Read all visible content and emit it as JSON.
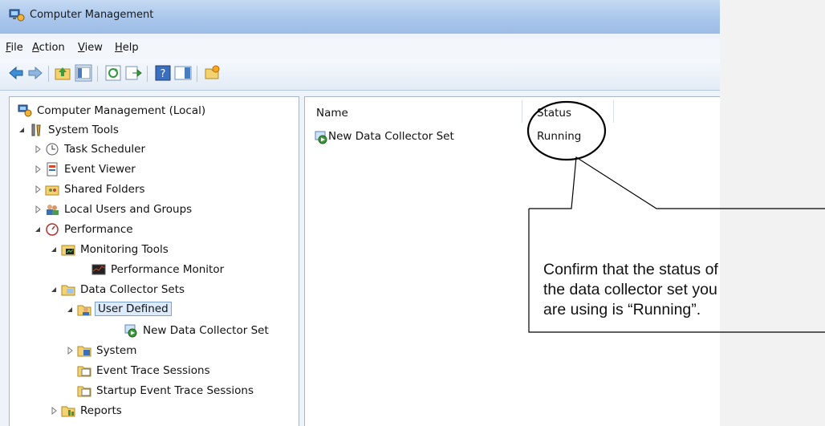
{
  "window": {
    "title": "Computer Management"
  },
  "menu": [
    {
      "label": "File",
      "underline": "F",
      "rest": "ile"
    },
    {
      "label": "Action",
      "underline": "A",
      "rest": "ction"
    },
    {
      "label": "View",
      "underline": "V",
      "rest": "iew"
    },
    {
      "label": "Help",
      "underline": "H",
      "rest": "elp"
    }
  ],
  "tree": {
    "root": "Computer Management (Local)",
    "system_tools": "System Tools",
    "task_scheduler": "Task Scheduler",
    "event_viewer": "Event Viewer",
    "shared_folders": "Shared Folders",
    "local_users": "Local Users and Groups",
    "performance": "Performance",
    "monitoring_tools": "Monitoring Tools",
    "performance_monitor": "Performance Monitor",
    "data_collector_sets": "Data Collector Sets",
    "user_defined": "User Defined",
    "new_dcs": "New Data Collector Set",
    "system": "System",
    "event_trace": "Event Trace Sessions",
    "startup_trace": "Startup Event Trace Sessions",
    "reports": "Reports"
  },
  "list": {
    "col_name": "Name",
    "col_status": "Status",
    "rows": [
      {
        "name": "New Data Collector Set",
        "status": "Running"
      }
    ]
  },
  "callout": {
    "lines": [
      "Confirm that the status of",
      "the data collector set you",
      "are using is “Running”."
    ]
  }
}
